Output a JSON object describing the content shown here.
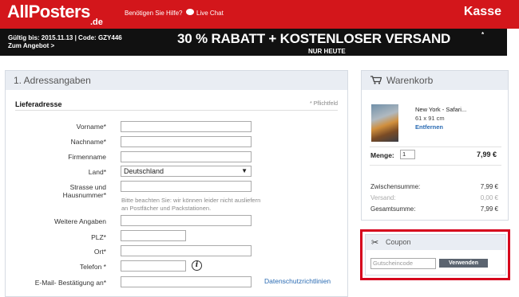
{
  "header": {
    "logo_text": "AllPosters",
    "logo_tld": ".de",
    "help_text": "Benötigen Sie Hilfe?",
    "live_chat": "Live Chat",
    "kasse": "Kasse"
  },
  "promo": {
    "line1": "Gültig bis: 2015.11.13 | Code: GZY446",
    "line2": "Zum Angebot >",
    "headline": "30 % RABATT + KOSTENLOSER VERSAND",
    "superscript": "*",
    "subline": "NUR HEUTE"
  },
  "address": {
    "section_title": "1. Adressangaben",
    "subsection": "Lieferadresse",
    "required_note": "* Pflichtfeld",
    "fields": {
      "vorname": "Vorname*",
      "nachname": "Nachname*",
      "firma": "Firmenname",
      "land": "Land*",
      "land_value": "Deutschland",
      "strasse_1": "Strasse und",
      "strasse_2": "Hausnummer*",
      "strasse_note_1": "Bitte beachten Sie: wir können leider nicht ausliefern",
      "strasse_note_2": "an Postfächer und Packstationen.",
      "weitere": "Weitere Angaben",
      "plz": "PLZ*",
      "ort": "Ort*",
      "telefon": "Telefon *",
      "email": "E-Mail- Bestätigung an*"
    },
    "privacy_link": "Datenschutzrichtlinien"
  },
  "cart": {
    "title": "Warenkorb",
    "product_name": "New York - Safari...",
    "product_size": "61 x 91 cm",
    "remove": "Entfernen",
    "quantity_label": "Menge:",
    "quantity_value": "1",
    "price": "7,99 €",
    "subtotal_label": "Zwischensumme:",
    "subtotal_value": "7,99 €",
    "shipping_label": "Versand:",
    "shipping_value": "0,00 €",
    "total_label": "Gesamtsumme:",
    "total_value": "7,99 €"
  },
  "coupon": {
    "title": "Coupon",
    "placeholder": "Gutscheincode",
    "button": "Verwenden"
  },
  "colors": {
    "brand_red": "#d3161b",
    "promo_black": "#111111",
    "link_blue": "#2a6bb3",
    "highlight_red": "#d6001c"
  }
}
